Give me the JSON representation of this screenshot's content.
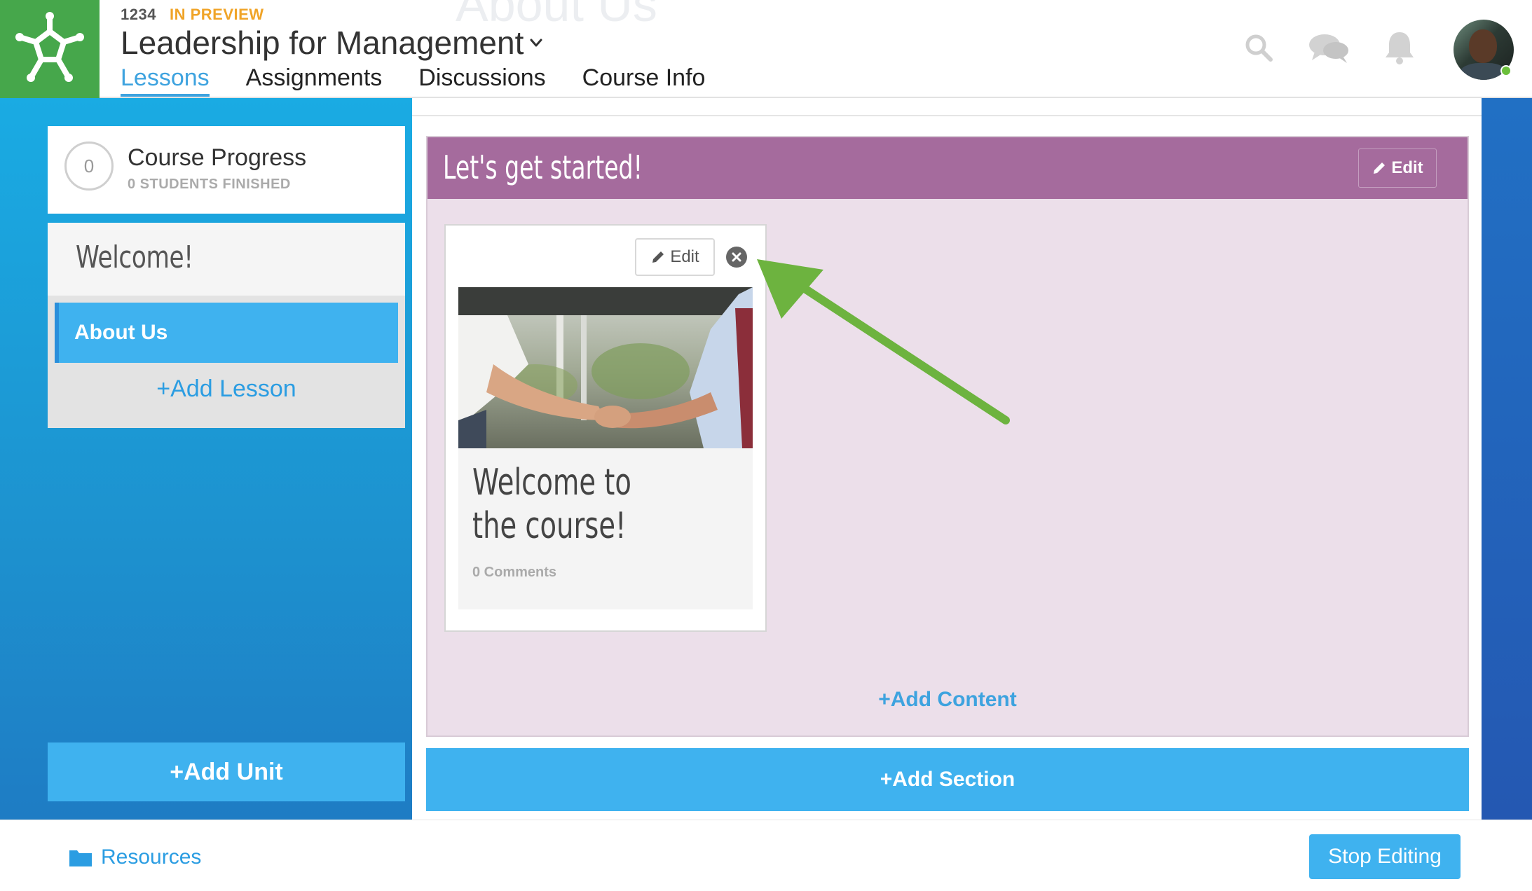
{
  "header": {
    "course_code": "1234",
    "status_badge": "IN PREVIEW",
    "course_title": "Leadership for Management",
    "ghost_title": "About Us",
    "tabs": [
      {
        "label": "Lessons",
        "active": true
      },
      {
        "label": "Assignments",
        "active": false
      },
      {
        "label": "Discussions",
        "active": false
      },
      {
        "label": "Course Info",
        "active": false
      }
    ],
    "icons": [
      "search-icon",
      "chat-icon",
      "bell-icon"
    ],
    "user_status": "online"
  },
  "sidebar": {
    "progress": {
      "count": "0",
      "title": "Course Progress",
      "subtitle": "0 STUDENTS FINISHED"
    },
    "unit": {
      "title": "Welcome!",
      "lessons": [
        {
          "label": "About Us",
          "selected": true
        }
      ],
      "add_lesson_label": "+Add Lesson"
    },
    "add_unit_label": "+Add Unit"
  },
  "main": {
    "section": {
      "title": "Let's get started!",
      "edit_label": "Edit",
      "card": {
        "edit_label": "Edit",
        "image": "handshake photo",
        "title": "Welcome to the course!",
        "comments": "0 Comments"
      },
      "add_content_label": "+Add Content"
    },
    "add_section_label": "+Add Section"
  },
  "footer": {
    "resources_label": "Resources",
    "stop_editing_label": "Stop Editing"
  },
  "colors": {
    "brand_green": "#46a74b",
    "accent_blue": "#3fb2ef",
    "tab_active": "#3ea3df",
    "preview_orange": "#f0a428",
    "section_purple": "#a56b9d",
    "section_bg": "#ecdfea",
    "annotation_arrow": "#6db33f"
  }
}
